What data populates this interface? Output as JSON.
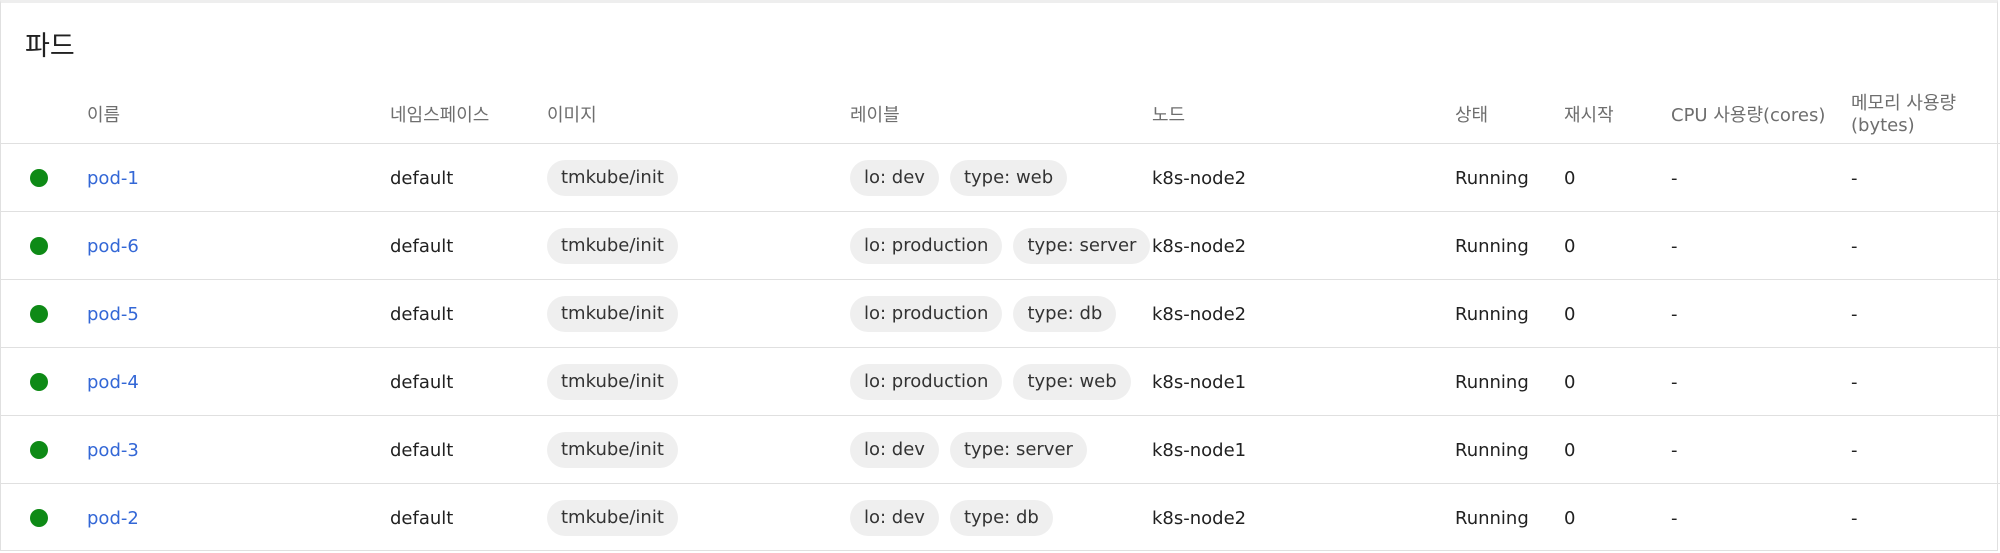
{
  "page": {
    "title": "파드"
  },
  "columns": {
    "name": "이름",
    "namespace": "네임스페이스",
    "image": "이미지",
    "labels": "레이블",
    "node": "노드",
    "status": "상태",
    "restarts": "재시작",
    "cpu": "CPU 사용량(cores)",
    "memory_line1": "메모리 사용량",
    "memory_line2": "(bytes)"
  },
  "pods": [
    {
      "status_icon": "green-circle-icon",
      "name": "pod-1",
      "namespace": "default",
      "image": "tmkube/init",
      "labels": [
        "lo: dev",
        "type: web"
      ],
      "node": "k8s-node2",
      "status": "Running",
      "restarts": "0",
      "cpu": "-",
      "memory": "-"
    },
    {
      "status_icon": "green-circle-icon",
      "name": "pod-6",
      "namespace": "default",
      "image": "tmkube/init",
      "labels": [
        "lo: production",
        "type: server"
      ],
      "node": "k8s-node2",
      "status": "Running",
      "restarts": "0",
      "cpu": "-",
      "memory": "-"
    },
    {
      "status_icon": "green-circle-icon",
      "name": "pod-5",
      "namespace": "default",
      "image": "tmkube/init",
      "labels": [
        "lo: production",
        "type: db"
      ],
      "node": "k8s-node2",
      "status": "Running",
      "restarts": "0",
      "cpu": "-",
      "memory": "-"
    },
    {
      "status_icon": "green-circle-icon",
      "name": "pod-4",
      "namespace": "default",
      "image": "tmkube/init",
      "labels": [
        "lo: production",
        "type: web"
      ],
      "node": "k8s-node1",
      "status": "Running",
      "restarts": "0",
      "cpu": "-",
      "memory": "-"
    },
    {
      "status_icon": "green-circle-icon",
      "name": "pod-3",
      "namespace": "default",
      "image": "tmkube/init",
      "labels": [
        "lo: dev",
        "type: server"
      ],
      "node": "k8s-node1",
      "status": "Running",
      "restarts": "0",
      "cpu": "-",
      "memory": "-"
    },
    {
      "status_icon": "green-circle-icon",
      "name": "pod-2",
      "namespace": "default",
      "image": "tmkube/init",
      "labels": [
        "lo: dev",
        "type: db"
      ],
      "node": "k8s-node2",
      "status": "Running",
      "restarts": "0",
      "cpu": "-",
      "memory": "-"
    }
  ],
  "colors": {
    "status_ok": "#0e8a16",
    "link": "#3367d6"
  }
}
